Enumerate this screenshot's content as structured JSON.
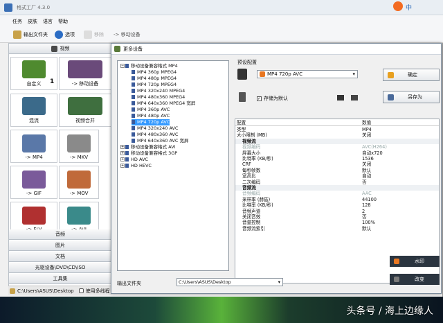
{
  "app": {
    "title": "格式工厂 4.3.0"
  },
  "tray": {
    "label": "中"
  },
  "menu": [
    "任务",
    "皮肤",
    "语言",
    "帮助"
  ],
  "toolbar": {
    "output_folder": "输出文件夹",
    "options": "选项",
    "remove": "移除",
    "breadcrumb": "-> 移动设备"
  },
  "sidebar": {
    "video_header": "视频",
    "tiles": [
      "自定义",
      "-> 移动设备",
      "混流",
      "视频合并",
      "-> MP4",
      "-> MKV",
      "-> GIF",
      "-> MOV",
      "-> FLV",
      "-> AVI"
    ],
    "tile_badge": "1",
    "categories": [
      "音频",
      "图片",
      "文档",
      "光驱设备\\DVD\\CD\\ISO",
      "工具集"
    ]
  },
  "status": {
    "path": "C:\\Users\\ASUS\\Desktop",
    "checkbox": "使用多线程"
  },
  "dialog": {
    "title": "更多设备",
    "tree": [
      {
        "label": "移动设备兼容格式 MP4",
        "level": 0,
        "expanded": true
      },
      {
        "label": "MP4 360p MPEG4",
        "level": 1
      },
      {
        "label": "MP4 480p MPEG4",
        "level": 1
      },
      {
        "label": "MP4 720p MPEG4",
        "level": 1
      },
      {
        "label": "MP4 320x240 MPEG4",
        "level": 1
      },
      {
        "label": "MP4 480x360 MPEG4",
        "level": 1
      },
      {
        "label": "MP4 640x360 MPEG4 宽屏",
        "level": 1
      },
      {
        "label": "MP4 360p AVC",
        "level": 1
      },
      {
        "label": "MP4 480p AVC",
        "level": 1
      },
      {
        "label": "MP4 720p AVC",
        "level": 1,
        "selected": true
      },
      {
        "label": "MP4 320x240 AVC",
        "level": 1
      },
      {
        "label": "MP4 480x360 AVC",
        "level": 1
      },
      {
        "label": "MP4 640x360 AVC 宽屏",
        "level": 1
      },
      {
        "label": "移动设备兼容格式 AVI",
        "level": 0
      },
      {
        "label": "移动设备兼容格式 3GP",
        "level": 0
      },
      {
        "label": "HD AVC",
        "level": 0
      },
      {
        "label": "HD HEVC",
        "level": 0
      }
    ],
    "preset_label": "预设配置",
    "preset_value": "MP4 720p AVC",
    "ok": "确定",
    "save_as": "另存为",
    "save_default": "存储为默认",
    "save_default_checked": true,
    "props_header": [
      "配置",
      "数值"
    ],
    "props": [
      {
        "k": "类型",
        "v": "MP4"
      },
      {
        "k": "大小限制 (MB)",
        "v": "关闭"
      },
      {
        "k": "视频流",
        "v": "",
        "hd": true
      },
      {
        "k": "视频编码",
        "v": "AVC(H264)",
        "dim": true
      },
      {
        "k": "屏幕大小",
        "v": "自动x720"
      },
      {
        "k": "比特率 (KB/秒)",
        "v": "1536"
      },
      {
        "k": "CRF",
        "v": "关闭"
      },
      {
        "k": "每秒帧数",
        "v": "默认"
      },
      {
        "k": "宽高比",
        "v": "自动"
      },
      {
        "k": "二次编码",
        "v": "否"
      },
      {
        "k": "音频流",
        "v": "",
        "hd": true
      },
      {
        "k": "音频编码",
        "v": "AAC",
        "dim": true
      },
      {
        "k": "采样率 (赫兹)",
        "v": "44100"
      },
      {
        "k": "比特率 (KB/秒)",
        "v": "128"
      },
      {
        "k": "音频声道",
        "v": "2"
      },
      {
        "k": "关闭音效",
        "v": "否"
      },
      {
        "k": "音量控制",
        "v": "100%"
      },
      {
        "k": "音频流索引",
        "v": "默认"
      }
    ],
    "watermark": "水印",
    "output_folder_label": "输出文件夹",
    "output_folder_value": "C:\\Users\\ASUS\\Desktop",
    "rename": "改变"
  },
  "desktop_watermark": "头条号 / 海上边缘人"
}
